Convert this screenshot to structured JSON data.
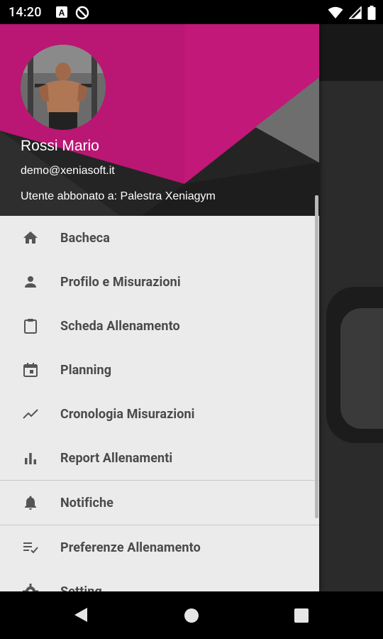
{
  "status_bar": {
    "time": "14:20",
    "left_icons": [
      "a-notification-icon",
      "no-disturb-icon"
    ],
    "right_icons": [
      "wifi-icon",
      "signal-icon",
      "battery-icon"
    ]
  },
  "drawer": {
    "header": {
      "user_name": "Rossi Mario",
      "email": "demo@xeniasoft.it",
      "subscription": "Utente abbonato a: Palestra Xeniagym",
      "accent_color": "#c2187a"
    },
    "menu_items": [
      {
        "label": "Bacheca",
        "icon": "home-icon"
      },
      {
        "label": "Profilo e Misurazioni",
        "icon": "person-icon"
      },
      {
        "label": "Scheda Allenamento",
        "icon": "clipboard-icon"
      },
      {
        "label": "Planning",
        "icon": "calendar-icon"
      },
      {
        "label": "Cronologia Misurazioni",
        "icon": "trend-icon"
      },
      {
        "label": "Report Allenamenti",
        "icon": "bar-chart-icon"
      },
      {
        "label": "Notifiche",
        "icon": "bell-icon"
      },
      {
        "label": "Preferenze Allenamento",
        "icon": "checklist-icon"
      },
      {
        "label": "Setting",
        "icon": "gear-icon"
      }
    ]
  },
  "nav_bar": {
    "buttons": [
      "back-icon",
      "home-circle-icon",
      "recents-icon"
    ]
  }
}
